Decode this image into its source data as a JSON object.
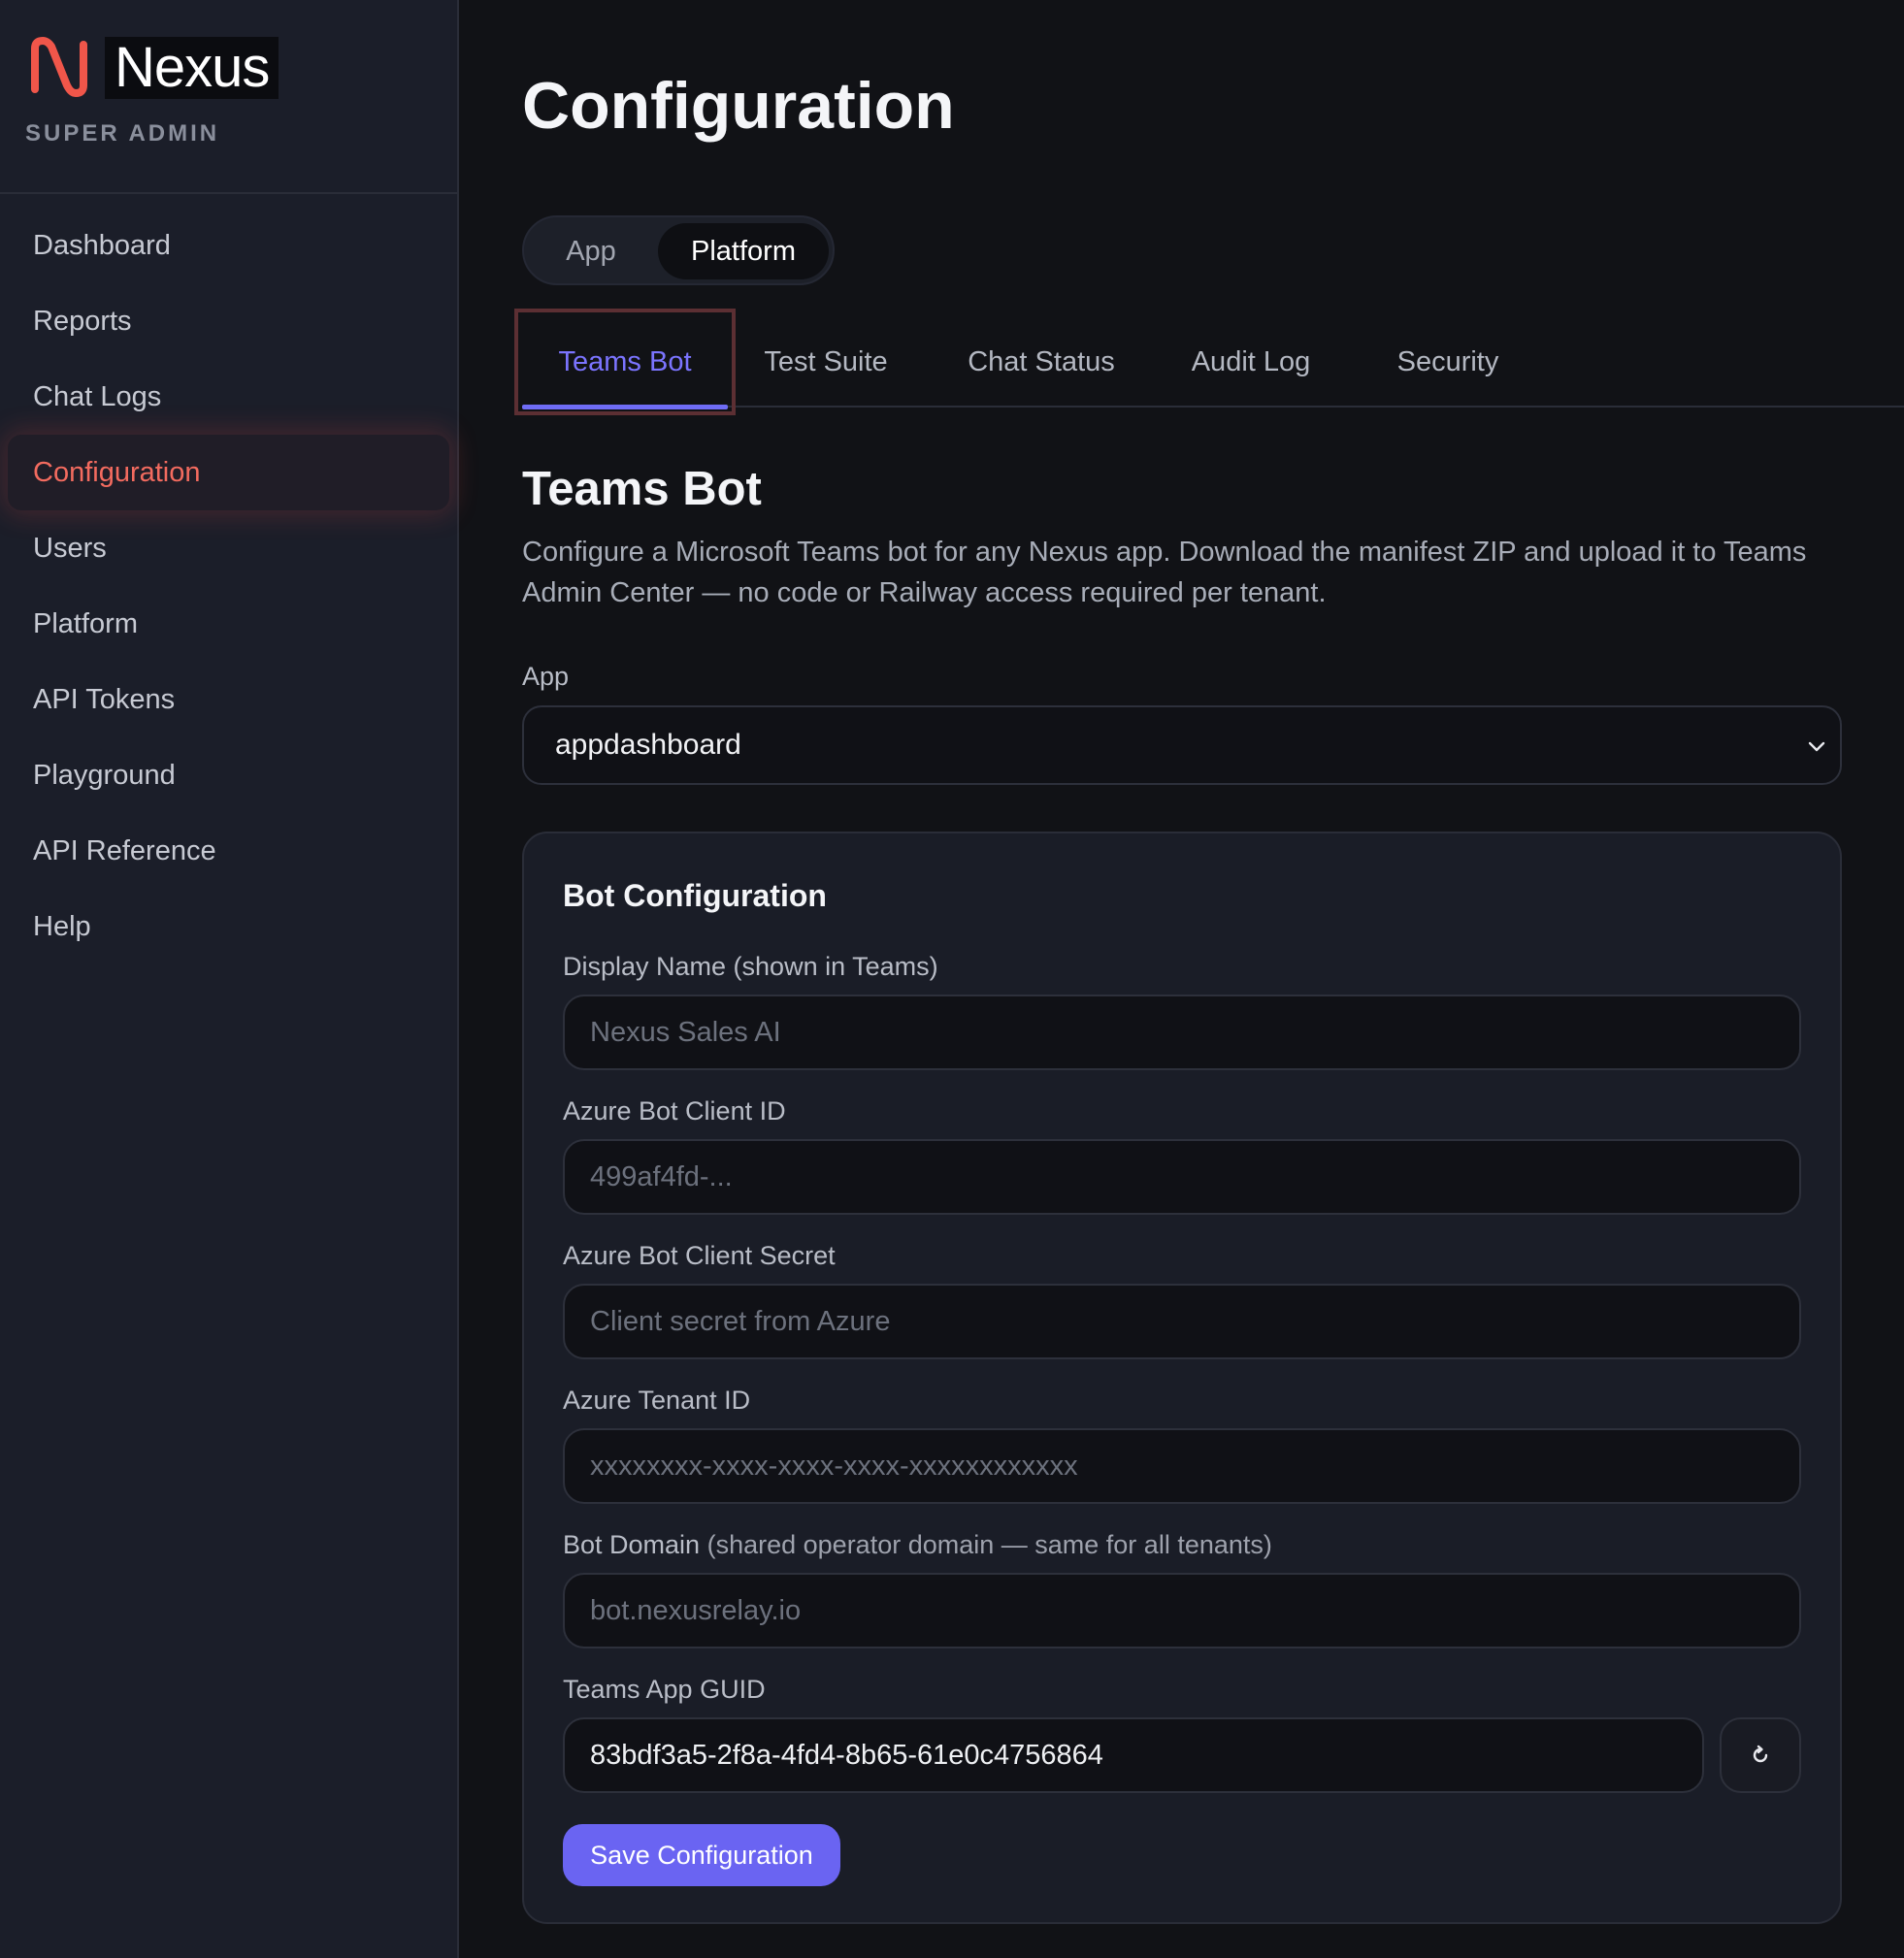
{
  "brand": {
    "name": "Nexus",
    "role": "SUPER ADMIN",
    "icon": "nexus-logo-icon"
  },
  "sidebar": {
    "items": [
      {
        "label": "Dashboard",
        "active": false
      },
      {
        "label": "Reports",
        "active": false
      },
      {
        "label": "Chat Logs",
        "active": false
      },
      {
        "label": "Configuration",
        "active": true
      },
      {
        "label": "Users",
        "active": false
      },
      {
        "label": "Platform",
        "active": false
      },
      {
        "label": "API Tokens",
        "active": false
      },
      {
        "label": "Playground",
        "active": false
      },
      {
        "label": "API Reference",
        "active": false
      },
      {
        "label": "Help",
        "active": false
      }
    ]
  },
  "page": {
    "title": "Configuration"
  },
  "segment": {
    "options": [
      "App",
      "Platform"
    ],
    "selected": "Platform"
  },
  "tabs": {
    "items": [
      "Teams Bot",
      "Test Suite",
      "Chat Status",
      "Audit Log",
      "Security"
    ],
    "selected": "Teams Bot"
  },
  "section": {
    "title": "Teams Bot",
    "description": "Configure a Microsoft Teams bot for any Nexus app. Download the manifest ZIP and upload it to Teams Admin Center — no code or Railway access required per tenant."
  },
  "app_select": {
    "label": "App",
    "value": "appdashboard",
    "icon": "chevron-down-icon"
  },
  "bot_config": {
    "title": "Bot Configuration",
    "display_name": {
      "label": "Display Name (shown in Teams)",
      "placeholder": "Nexus Sales AI",
      "value": ""
    },
    "client_id": {
      "label": "Azure Bot Client ID",
      "placeholder": "499af4fd-...",
      "value": ""
    },
    "client_secret": {
      "label": "Azure Bot Client Secret",
      "placeholder": "Client secret from Azure",
      "value": ""
    },
    "tenant_id": {
      "label": "Azure Tenant ID",
      "placeholder": "xxxxxxxx-xxxx-xxxx-xxxx-xxxxxxxxxxxx",
      "value": ""
    },
    "bot_domain": {
      "label": "Bot Domain",
      "hint": "(shared operator domain — same for all tenants)",
      "placeholder": "bot.nexusrelay.io",
      "value": ""
    },
    "app_guid": {
      "label": "Teams App GUID",
      "value": "83bdf3a5-2f8a-4fd4-8b65-61e0c4756864",
      "refresh_icon": "refresh-icon"
    },
    "save_label": "Save Configuration"
  },
  "colors": {
    "accent": "#6a64f2",
    "brand": "#f36b5f",
    "background": "#111216",
    "sidebar": "#1b1e29"
  }
}
